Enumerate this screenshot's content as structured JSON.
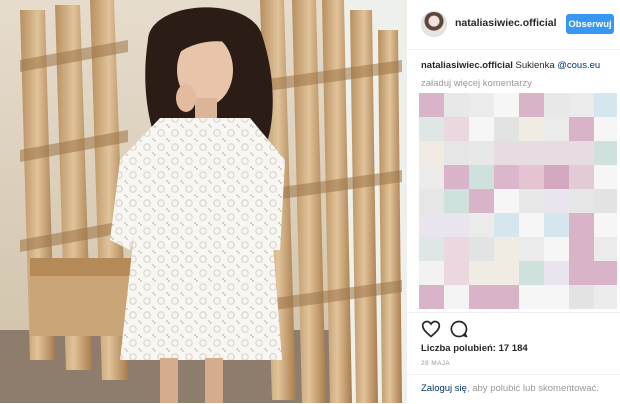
{
  "header": {
    "username": "nataliasiwiec.official",
    "follow_label": "Obserwuj"
  },
  "caption": {
    "user": "nataliasiwiec.official",
    "text": "Sukienka",
    "mention": "@cous.eu"
  },
  "comments": {
    "load_more": "załaduj więcej komentarzy"
  },
  "stats": {
    "likes": "Liczba polubień: 17 184",
    "date": "28 MAJA"
  },
  "login": {
    "link": "Zaloguj się",
    "text": ", aby polubić lub skomentować."
  },
  "icons": [
    "heart-icon",
    "comment-icon"
  ],
  "colors": {
    "follow_button": "#3897f0",
    "link": "#003569",
    "muted": "#999999",
    "text": "#262626"
  }
}
